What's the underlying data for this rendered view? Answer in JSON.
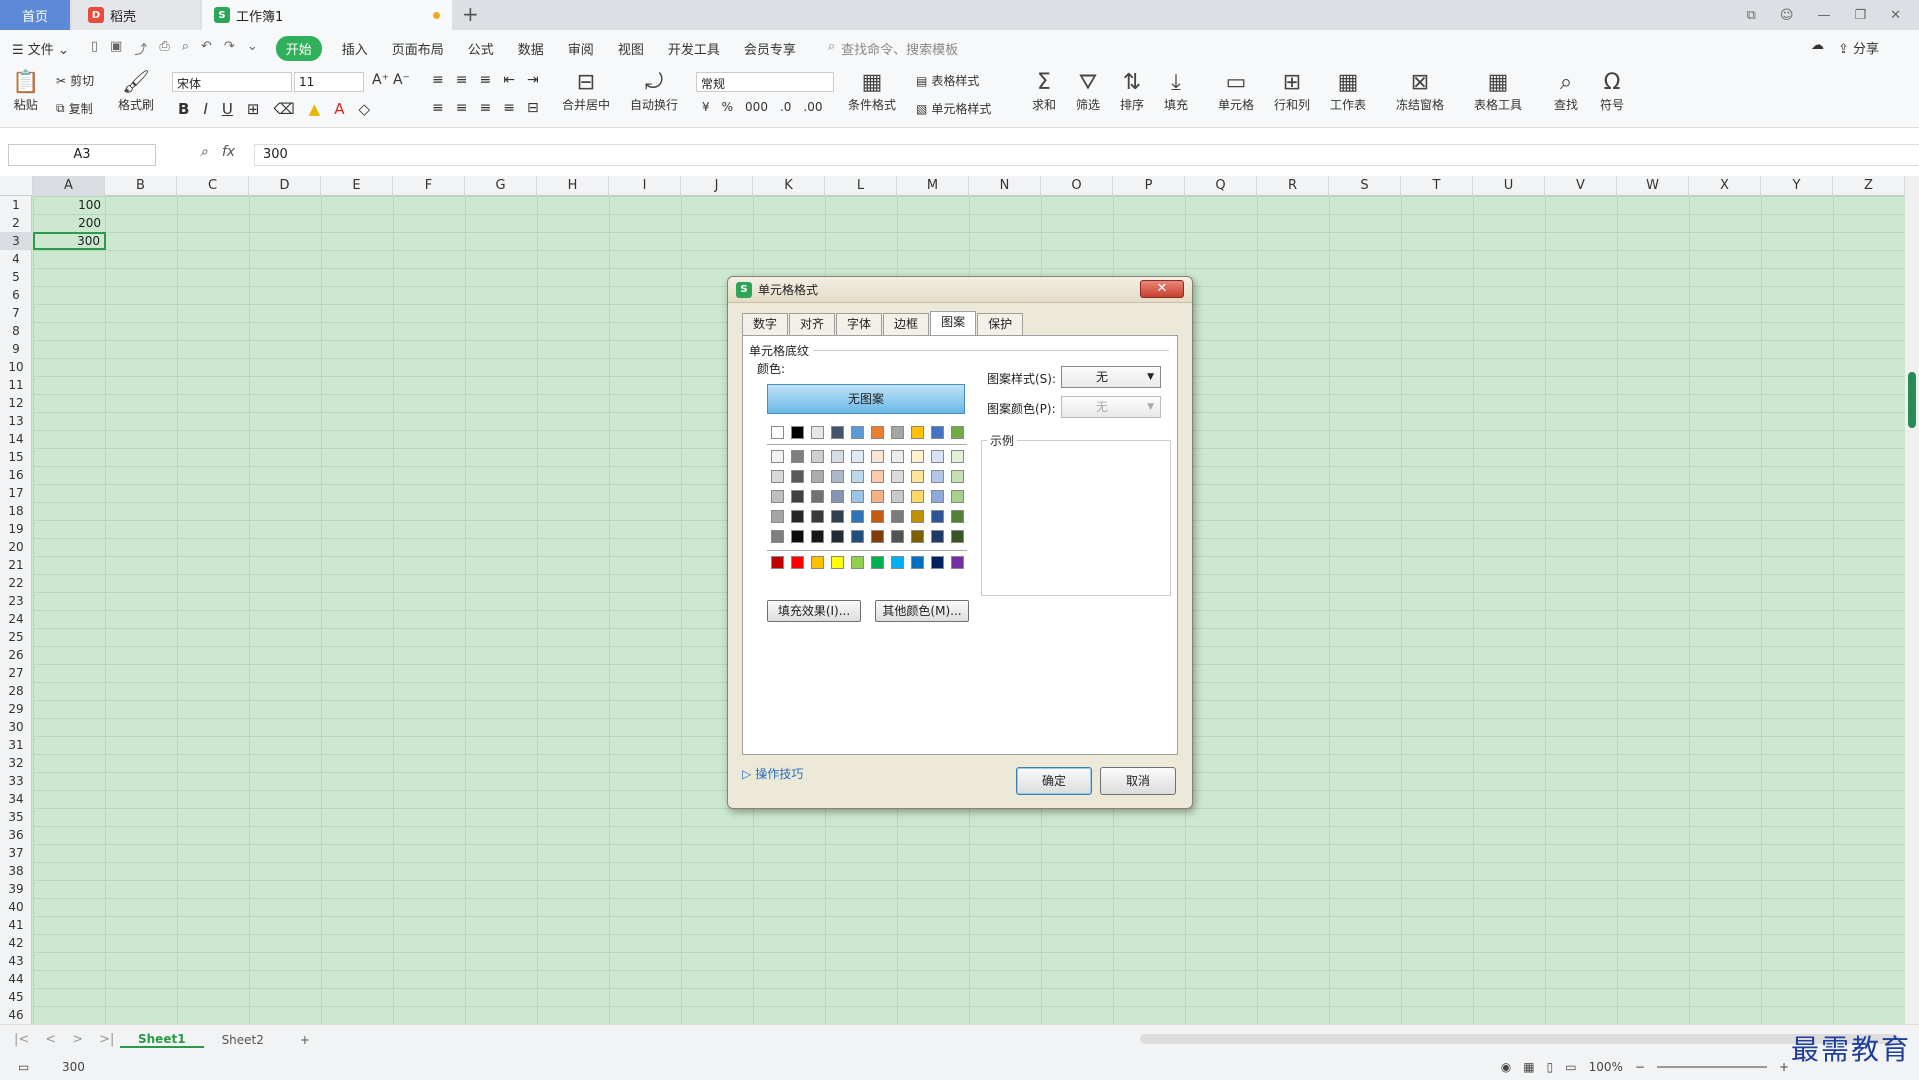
{
  "tabs": {
    "home": "首页",
    "draft": "稻壳",
    "book": "工作簿1"
  },
  "menu": {
    "file": "文件",
    "start": "开始",
    "insert": "插入",
    "layout": "页面布局",
    "formula": "公式",
    "data": "数据",
    "review": "审阅",
    "view": "视图",
    "dev": "开发工具",
    "member": "会员专享",
    "search_cmd": "查找命令、搜索模板",
    "share": "分享"
  },
  "ribbon": {
    "paste": "粘贴",
    "cut": "剪切",
    "copy": "复制",
    "format_painter": "格式刷",
    "font": "宋体",
    "size": "11",
    "merge": "合并居中",
    "wrap": "自动换行",
    "number_format": "常规",
    "cond_format": "条件格式",
    "table_style": "表格样式",
    "cell_style": "单元格样式",
    "sum": "求和",
    "filter": "筛选",
    "sort": "排序",
    "fill": "填充",
    "cell": "单元格",
    "rowcol": "行和列",
    "worksheet": "工作表",
    "freeze": "冻结窗格",
    "table_tools": "表格工具",
    "find": "查找",
    "symbol": "符号"
  },
  "formula_bar": {
    "name": "A3",
    "fx": "fx",
    "value": "300"
  },
  "columns": [
    "A",
    "B",
    "C",
    "D",
    "E",
    "F",
    "G",
    "H",
    "I",
    "J",
    "K",
    "L",
    "M",
    "N",
    "O",
    "P",
    "Q",
    "R",
    "S",
    "T",
    "U",
    "V",
    "W",
    "X",
    "Y",
    "Z"
  ],
  "cells": {
    "A1": "100",
    "A2": "200",
    "A3": "300"
  },
  "sheets": [
    "Sheet1",
    "Sheet2"
  ],
  "status": {
    "value": "300",
    "zoom": "100%"
  },
  "watermark": "最需教育",
  "dialog": {
    "title": "单元格格式",
    "tabs": [
      "数字",
      "对齐",
      "字体",
      "边框",
      "图案",
      "保护"
    ],
    "group": "单元格底纹",
    "color_label": "颜色:",
    "no_pattern": "无图案",
    "fill_effect": "填充效果(I)...",
    "more_colors": "其他颜色(M)...",
    "pattern_style_label": "图案样式(S):",
    "pattern_style_value": "无",
    "pattern_color_label": "图案颜色(P):",
    "pattern_color_value": "无",
    "sample_label": "示例",
    "tips": "操作技巧",
    "ok": "确定",
    "cancel": "取消"
  },
  "palette": {
    "theme_row": [
      "#ffffff",
      "#000000",
      "#e7e6e6",
      "#44546a",
      "#5b9bd5",
      "#ed7d31",
      "#a5a5a5",
      "#ffc000",
      "#4472c4",
      "#70ad47"
    ],
    "tints": [
      [
        "#f2f2f2",
        "#7f7f7f",
        "#d0cece",
        "#d6dce4",
        "#deebf6",
        "#fbe5d5",
        "#ededed",
        "#fff2cc",
        "#dae3f3",
        "#e2efd9"
      ],
      [
        "#d8d8d8",
        "#595959",
        "#aeabab",
        "#adb9ca",
        "#bdd7ee",
        "#f7cbac",
        "#dbdbdb",
        "#ffe599",
        "#b4c6e7",
        "#c5e0b3"
      ],
      [
        "#bfbfbf",
        "#3f3f3f",
        "#757070",
        "#8496b0",
        "#9dc3e6",
        "#f4b183",
        "#c9c9c9",
        "#ffd966",
        "#8eaadb",
        "#a8d08d"
      ],
      [
        "#a5a5a5",
        "#262626",
        "#3a3838",
        "#323f4f",
        "#2e75b5",
        "#c55a11",
        "#7b7b7b",
        "#bf9000",
        "#2f5496",
        "#538135"
      ],
      [
        "#7f7f7f",
        "#0c0c0c",
        "#171616",
        "#222a35",
        "#1e4e79",
        "#833c0b",
        "#525252",
        "#7f6000",
        "#1f3864",
        "#375623"
      ]
    ],
    "standard_row": [
      "#c00000",
      "#ff0000",
      "#ffc000",
      "#ffff00",
      "#92d050",
      "#00b050",
      "#00b0f0",
      "#0070c0",
      "#002060",
      "#7030a0"
    ]
  }
}
